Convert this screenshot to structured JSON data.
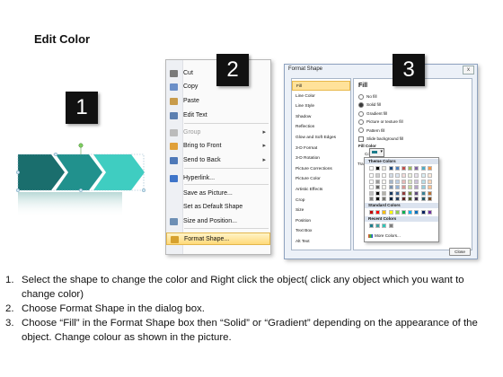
{
  "title": "Edit Color",
  "badges": [
    "1",
    "2",
    "3"
  ],
  "context_menu": {
    "items": [
      {
        "label": "Cut",
        "icon": "scissors-icon",
        "disabled": false,
        "submenu": false,
        "highlighted": false
      },
      {
        "label": "Copy",
        "icon": "copy-icon",
        "disabled": false,
        "submenu": false,
        "highlighted": false
      },
      {
        "label": "Paste",
        "icon": "paste-icon",
        "disabled": false,
        "submenu": false,
        "highlighted": false
      },
      {
        "label": "Edit Text",
        "icon": "edit-text-icon",
        "disabled": false,
        "submenu": false,
        "highlighted": false
      },
      {
        "label": "Group",
        "icon": "group-icon",
        "disabled": true,
        "submenu": true,
        "highlighted": false
      },
      {
        "label": "Bring to Front",
        "icon": "bring-to-front-icon",
        "disabled": false,
        "submenu": true,
        "highlighted": false
      },
      {
        "label": "Send to Back",
        "icon": "send-to-back-icon",
        "disabled": false,
        "submenu": true,
        "highlighted": false
      },
      {
        "label": "Hyperlink...",
        "icon": "hyperlink-icon",
        "disabled": false,
        "submenu": false,
        "highlighted": false
      },
      {
        "label": "Save as Picture...",
        "icon": "",
        "disabled": false,
        "submenu": false,
        "highlighted": false
      },
      {
        "label": "Set as Default Shape",
        "icon": "",
        "disabled": false,
        "submenu": false,
        "highlighted": false
      },
      {
        "label": "Size and Position...",
        "icon": "size-position-icon",
        "disabled": false,
        "submenu": false,
        "highlighted": false
      },
      {
        "label": "Format Shape...",
        "icon": "format-shape-icon",
        "disabled": false,
        "submenu": false,
        "highlighted": true
      }
    ]
  },
  "dialog": {
    "title": "Format Shape",
    "close_label": "x",
    "nav": [
      "Fill",
      "Line Color",
      "Line Style",
      "Shadow",
      "Reflection",
      "Glow and Soft Edges",
      "3-D Format",
      "3-D Rotation",
      "Picture Corrections",
      "Picture Color",
      "Artistic Effects",
      "Crop",
      "Size",
      "Position",
      "Text Box",
      "Alt Text"
    ],
    "selected_nav": "Fill",
    "panel_heading": "Fill",
    "fill_options": [
      "No fill",
      "Solid fill",
      "Gradient fill",
      "Picture or texture fill",
      "Pattern fill"
    ],
    "selected_fill": "Solid fill",
    "slide_background_label": "Slide background fill",
    "fill_color_label": "Fill Color",
    "color_label": "Color:",
    "transparency_label": "Transpa",
    "close_button": "Close",
    "popup": {
      "theme_label": "Theme Colors",
      "standard_label": "Standard Colors",
      "recent_label": "Recent Colors",
      "more_label": "More Colors...",
      "theme_top": [
        "#ffffff",
        "#000000",
        "#eeece1",
        "#1f497d",
        "#4f81bd",
        "#c0504d",
        "#9bbb59",
        "#8064a2",
        "#4bacc6",
        "#f79646"
      ],
      "standard": [
        "#c00000",
        "#ff0000",
        "#ffc000",
        "#ffff00",
        "#92d050",
        "#00b050",
        "#00b0f0",
        "#0070c0",
        "#002060",
        "#7030a0"
      ],
      "recent": [
        "#1b7c8c",
        "#3c9fa0",
        "#2fc6b8",
        "#7f7f7f"
      ]
    }
  },
  "shapes": {
    "colors": [
      "#1a6e6d",
      "#21918d",
      "#3fcdc1"
    ]
  },
  "instructions": [
    {
      "num": "1.",
      "text": "Select the shape to change the color and Right click the object( click any object which you want to change color)"
    },
    {
      "num": "2.",
      "text": "Choose Format Shape in the dialog box."
    },
    {
      "num": "3.",
      "text": "Choose “Fill” in the Format Shape box then “Solid” or “Gradient” depending on the appearance of the object. Change colour as shown in the picture."
    }
  ]
}
